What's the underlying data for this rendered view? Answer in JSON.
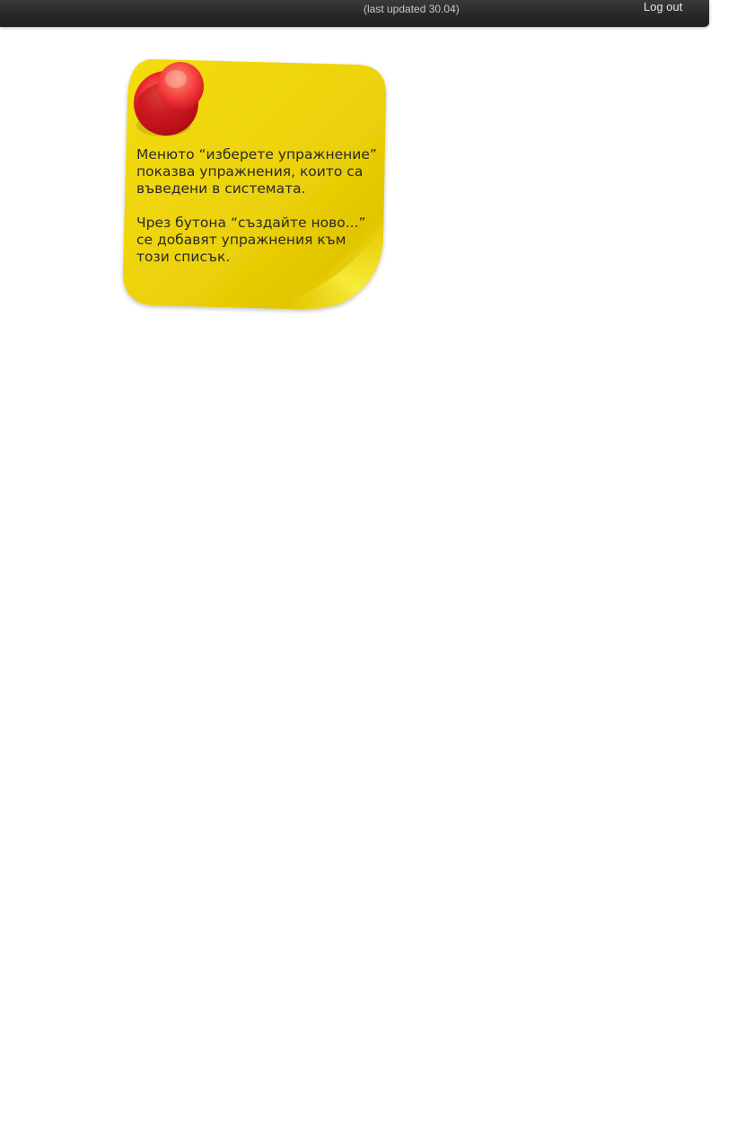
{
  "header": {
    "last_updated": "(last updated 30.04)",
    "logout_label": "Log out"
  },
  "note": {
    "icon": "pushpin-icon",
    "paragraph_1": "Менюто “изберете упражнение”\nпоказва упражнения, които са\nвъведени в системата.",
    "paragraph_2": "Чрез бутона “създайте ново...”\nсе добавят упражнения към\nтози списък."
  },
  "colors": {
    "topbar": "#262626",
    "note_yellow": "#f2dd10",
    "pin_red": "#d8141c"
  }
}
